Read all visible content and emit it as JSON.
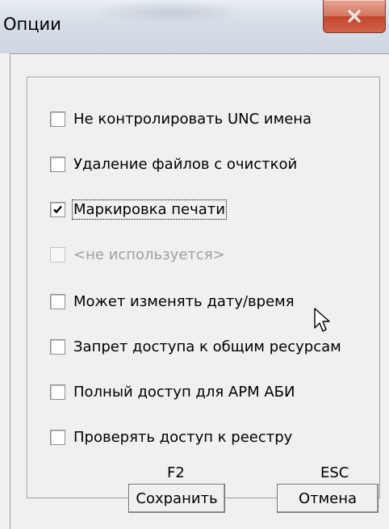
{
  "window": {
    "title": "Опции"
  },
  "options": [
    {
      "label": "Не контролировать UNC имена",
      "checked": false,
      "enabled": true
    },
    {
      "label": "Удаление файлов с очисткой",
      "checked": false,
      "enabled": true
    },
    {
      "label": "Маркировка печати",
      "checked": true,
      "enabled": true,
      "focused": true
    },
    {
      "label": "<не используется>",
      "checked": false,
      "enabled": false
    },
    {
      "label": "Может изменять дату/время",
      "checked": false,
      "enabled": true
    },
    {
      "label": "Запрет доступа к общим ресурсам",
      "checked": false,
      "enabled": true
    },
    {
      "label": "Полный доступ для АРМ АБИ",
      "checked": false,
      "enabled": true
    },
    {
      "label": "Проверять доступ к реестру",
      "checked": false,
      "enabled": true
    }
  ],
  "buttons": {
    "save": {
      "hotkey": "F2",
      "label": "Сохранить"
    },
    "cancel": {
      "hotkey": "ESC",
      "label": "Отмена"
    }
  },
  "icons": {
    "close": "close-icon",
    "cursor": "mouse-pointer-icon",
    "check": "checkmark-icon"
  }
}
